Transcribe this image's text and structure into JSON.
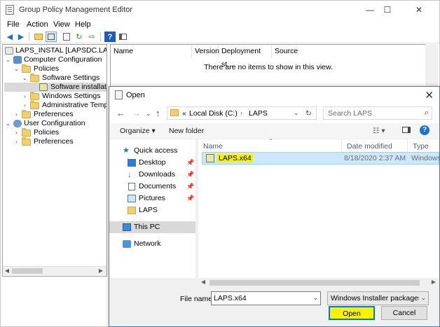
{
  "window": {
    "title": "Group Policy Management Editor",
    "controls": {
      "minimize": "—",
      "maximize": "☐",
      "close": "✕"
    }
  },
  "menu": [
    "File",
    "Action",
    "View",
    "Help"
  ],
  "tree": {
    "root": "LAPS_INSTAL [LAPSDC.LAPS.CC",
    "items": [
      "Computer Configuration",
      "Policies",
      "Software Settings",
      "Software installat",
      "Windows Settings",
      "Administrative Temp",
      "Preferences",
      "User Configuration",
      "Policies",
      "Preferences"
    ]
  },
  "list": {
    "columns": [
      "Name",
      "Version",
      "Deployment st...",
      "Source"
    ],
    "empty_message": "There are no items to show in this view."
  },
  "dialog": {
    "title": "Open",
    "close_glyph": "✕",
    "address": {
      "prefix": "«",
      "segments": [
        "Local Disk (C:)",
        "LAPS"
      ]
    },
    "search_placeholder": "Search LAPS",
    "toolbar": {
      "organize": "Organize ▾",
      "new_folder": "New folder"
    },
    "nav_items": [
      {
        "label": "Quick access",
        "icon": "star-icon"
      },
      {
        "label": "Desktop",
        "icon": "desktop-icon"
      },
      {
        "label": "Downloads",
        "icon": "download-icon"
      },
      {
        "label": "Documents",
        "icon": "documents-icon"
      },
      {
        "label": "Pictures",
        "icon": "pictures-icon"
      },
      {
        "label": "LAPS",
        "icon": "folder-icon"
      },
      {
        "label": "This PC",
        "icon": "computer-icon"
      },
      {
        "label": "Network",
        "icon": "network-icon"
      }
    ],
    "columns": [
      "Name",
      "Date modified",
      "Type"
    ],
    "files": [
      {
        "name": "LAPS.x64",
        "date": "8/18/2020 2:37 AM",
        "type": "Windows"
      }
    ],
    "file_name_label": "File name:",
    "file_name_value": "LAPS.x64",
    "file_type": "Windows Installer packages (*.r",
    "open_label": "Open",
    "cancel_label": "Cancel"
  },
  "colors": {
    "highlight": "#f6f200",
    "selection": "#cce8ff",
    "accent": "#0078d7"
  }
}
